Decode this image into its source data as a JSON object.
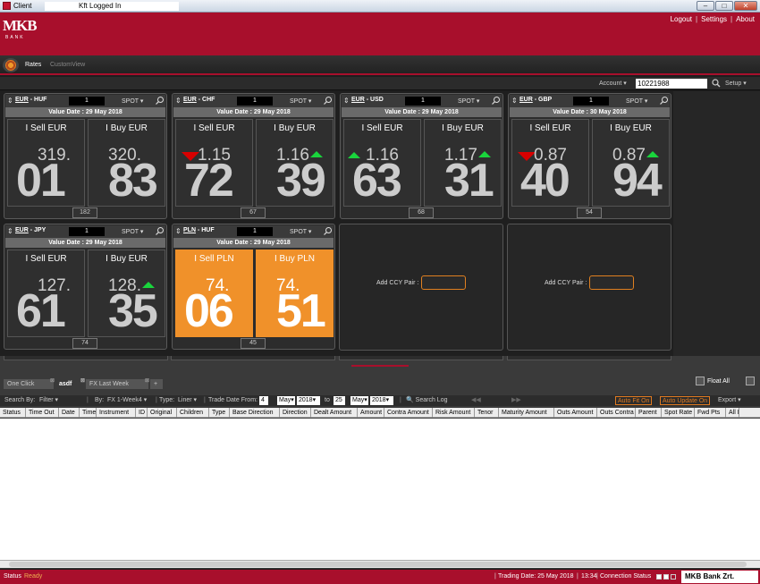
{
  "window": {
    "title": "Client",
    "subtitle": "Kft Logged In"
  },
  "top_links": {
    "logout": "Logout",
    "settings": "Settings",
    "about": "About"
  },
  "brand": {
    "logo_top": "MKB",
    "logo_bottom": "BANK",
    "color": "#a80f2c"
  },
  "nav": {
    "tabs": [
      "Rates",
      "CustomView"
    ]
  },
  "account": {
    "label": "Account",
    "value": "10221988",
    "setup": "Setup"
  },
  "tiles": [
    {
      "pair_a": "EUR",
      "pair_b": "HUF",
      "amount": "1",
      "tenor": "SPOT",
      "value_date": "Value Date : 29 May 2018",
      "sell_label": "I Sell EUR",
      "buy_label": "I Buy EUR",
      "sell_small": "319.",
      "sell_big": "01",
      "buy_small": "320.",
      "buy_big": "83",
      "spread": "182",
      "sell_arrow": "",
      "buy_arrow": ""
    },
    {
      "pair_a": "EUR",
      "pair_b": "CHF",
      "amount": "1",
      "tenor": "SPOT",
      "value_date": "Value Date : 29 May 2018",
      "sell_label": "I Sell EUR",
      "buy_label": "I Buy EUR",
      "sell_small": "1.15",
      "sell_big": "72",
      "buy_small": "1.16",
      "buy_big": "39",
      "spread": "67",
      "sell_arrow": "down",
      "buy_arrow": "up"
    },
    {
      "pair_a": "EUR",
      "pair_b": "USD",
      "amount": "1",
      "tenor": "SPOT",
      "value_date": "Value Date : 29 May 2018",
      "sell_label": "I Sell EUR",
      "buy_label": "I Buy EUR",
      "sell_small": "1.16",
      "sell_big": "63",
      "buy_small": "1.17",
      "buy_big": "31",
      "spread": "68",
      "sell_arrow": "up",
      "buy_arrow": "up"
    },
    {
      "pair_a": "EUR",
      "pair_b": "GBP",
      "amount": "1",
      "tenor": "SPOT",
      "value_date": "Value Date : 30 May 2018",
      "sell_label": "I Sell EUR",
      "buy_label": "I Buy EUR",
      "sell_small": "0.87",
      "sell_big": "40",
      "buy_small": "0.87",
      "buy_big": "94",
      "spread": "54",
      "sell_arrow": "down",
      "buy_arrow": "up"
    },
    {
      "pair_a": "EUR",
      "pair_b": "JPY",
      "amount": "1",
      "tenor": "SPOT",
      "value_date": "Value Date : 29 May 2018",
      "sell_label": "I Sell EUR",
      "buy_label": "I Buy EUR",
      "sell_small": "127.",
      "sell_big": "61",
      "buy_small": "128.",
      "buy_big": "35",
      "spread": "74",
      "sell_arrow": "",
      "buy_arrow": "up"
    },
    {
      "pair_a": "PLN",
      "pair_b": "HUF",
      "amount": "1",
      "tenor": "SPOT",
      "value_date": "Value Date : 29 May 2018",
      "sell_label": "I Sell PLN",
      "buy_label": "I Buy PLN",
      "sell_small": "74.",
      "sell_big": "06",
      "buy_small": "74.",
      "buy_big": "51",
      "spread": "45",
      "sell_arrow": "",
      "buy_arrow": ""
    }
  ],
  "empty_tiles": [
    {
      "label": "Add CCY Pair :"
    },
    {
      "label": "Add CCY Pair :"
    }
  ],
  "bottom_tabs": [
    {
      "label": "One Click"
    },
    {
      "label": "asdf"
    },
    {
      "label": "FX Last Week"
    },
    {
      "label": "+"
    }
  ],
  "float_all": "Float All",
  "filters": {
    "search_by_label": "Search By:",
    "search_by_value": "Filter",
    "by_label": "By:",
    "by_value": "FX 1-Week4",
    "type_label": "Type:",
    "type_value": "Liner",
    "trade_date_from": "Trade Date From:",
    "from_day": "4",
    "from_month": "May",
    "from_year": "2018",
    "to_label": "to",
    "to_day": "25",
    "to_month": "May",
    "to_year": "2018",
    "search_log": "Search Log",
    "auto_fit": "Auto Fit On",
    "auto_update": "Auto Update On",
    "export": "Export"
  },
  "grid_columns": [
    "Status",
    "Time Out",
    "Date",
    "Time",
    "Instrument",
    "ID",
    "Original",
    "Children",
    "Type",
    "Base Direction",
    "Direction",
    "Dealt Amount",
    "Amount",
    "Contra Amount",
    "Risk Amount",
    "Tenor",
    "Maturity Amount",
    "Outs Amount",
    "Outs Contra",
    "Parent",
    "Spot Rate",
    "Fwd Pts",
    "All I"
  ],
  "status": {
    "label": "Status",
    "value": "Ready",
    "trading_date": "Trading Date: 25 May 2018",
    "time": "13:34",
    "connection": "Connection Status",
    "bank": "MKB Bank Zrt."
  },
  "colors": {
    "accent": "#a80f2c",
    "orange": "#f0912a",
    "up": "#19d53c",
    "down": "#d80000"
  }
}
